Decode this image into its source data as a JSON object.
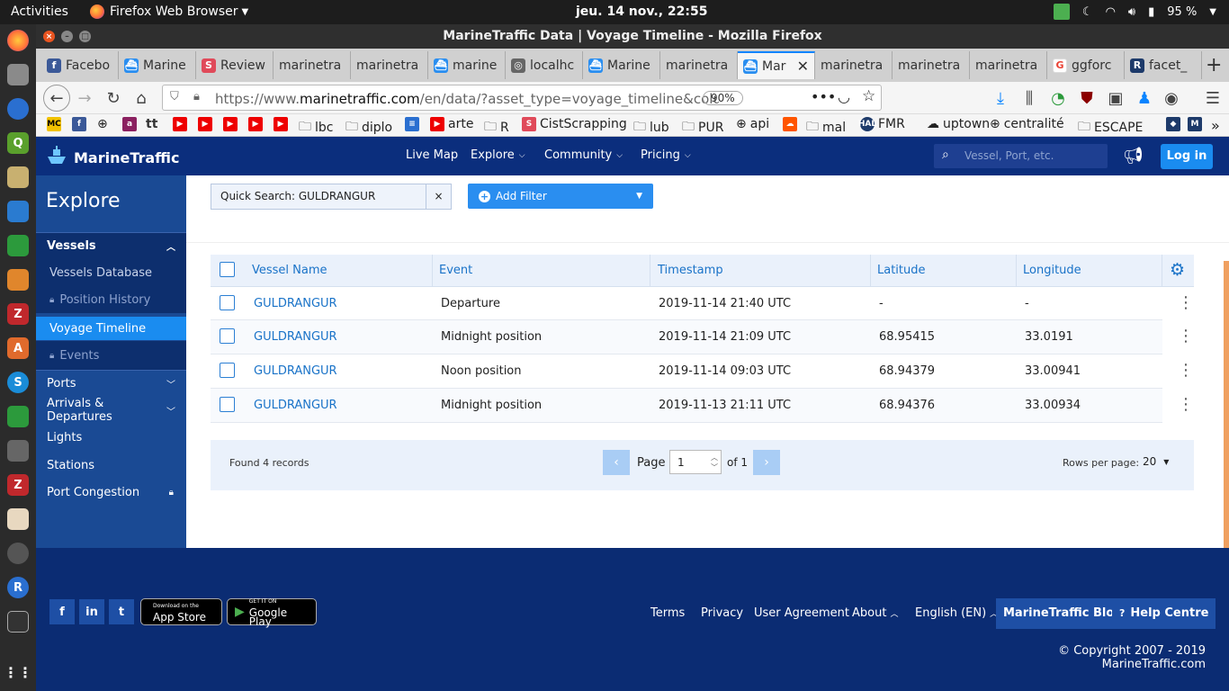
{
  "topbar": {
    "activities": "Activities",
    "app": "Firefox Web Browser",
    "clock": "jeu. 14 nov., 22:55",
    "battery": "95 %"
  },
  "window": {
    "title": "MarineTraffic Data | Voyage Timeline - Mozilla Firefox"
  },
  "tabs": [
    "Facebo",
    "Marine",
    "Review",
    "marinetra",
    "marinetra",
    "marine",
    "localhc",
    "Marine",
    "marinetra",
    "Mar",
    "marinetra",
    "marinetra",
    "marinetra",
    "ggforc",
    "facet_"
  ],
  "navbar": {
    "url_prefix": "https://www.",
    "url_domain": "marinetraffic.com",
    "url_rest": "/en/data/?asset_type=voyage_timeline&columns=sh",
    "zoom": "90%"
  },
  "bookmarks": [
    "lbc",
    "diplo",
    "arte",
    "R",
    "CistScrapping",
    "lub",
    "PUR",
    "api",
    "mal",
    "FMR",
    "uptown",
    "centralité",
    "ESCAPE"
  ],
  "site": {
    "logo": "MarineTraffic",
    "nav": [
      "Live Map",
      "Explore",
      "Community",
      "Pricing"
    ],
    "search_placeholder": "Vessel, Port, etc.",
    "login": "Log in"
  },
  "sidebar": {
    "title": "Explore",
    "vessels": "Vessels",
    "vessels_items": [
      "Vessels Database",
      "Position History",
      "Voyage Timeline",
      "Events"
    ],
    "items": [
      "Ports",
      "Arrivals & Departures",
      "Lights",
      "Stations",
      "Port Congestion"
    ]
  },
  "filters": {
    "quick_search": "Quick Search: GULDRANGUR",
    "clear": "×",
    "add_filter": "Add Filter"
  },
  "table": {
    "headers": [
      "Vessel Name",
      "Event",
      "Timestamp",
      "Latitude",
      "Longitude"
    ],
    "rows": [
      [
        "GULDRANGUR",
        "Departure",
        "2019-11-14 21:40 UTC",
        "-",
        "-"
      ],
      [
        "GULDRANGUR",
        "Midnight position",
        "2019-11-14 21:09 UTC",
        "68.95415",
        "33.0191"
      ],
      [
        "GULDRANGUR",
        "Noon position",
        "2019-11-14 09:03 UTC",
        "68.94379",
        "33.00941"
      ],
      [
        "GULDRANGUR",
        "Midnight position",
        "2019-11-13 21:11 UTC",
        "68.94376",
        "33.00934"
      ]
    ]
  },
  "pager": {
    "found": "Found 4 records",
    "page_label": "Page",
    "page": "1",
    "of": "of 1",
    "rows_label": "Rows per page:",
    "rows": "20"
  },
  "footer": {
    "app_store_small": "Download on the",
    "app_store": "App Store",
    "play_small": "GET IT ON",
    "play": "Google Play",
    "links": [
      "Terms",
      "Privacy",
      "User Agreement",
      "About",
      "English (EN)"
    ],
    "blog": "MarineTraffic Blog",
    "help": "Help Centre",
    "copyright": "© Copyright 2007 - 2019 MarineTraffic.com"
  },
  "colors": {
    "brand": "#0b2e7d",
    "accent": "#1a8cf0",
    "sidebar": "#1a4a94",
    "active": "#1a8cf0"
  }
}
